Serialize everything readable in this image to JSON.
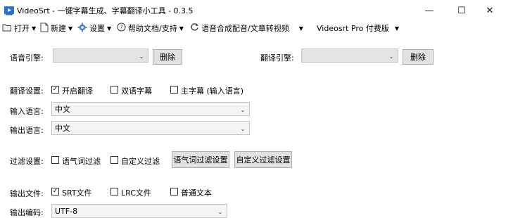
{
  "window": {
    "title": "VideoSrt - 一键字幕生成、字幕翻译小工具 - 0.3.5",
    "minimize": "—",
    "maximize": "☐",
    "close": "✕"
  },
  "menu": [
    {
      "label": "打开",
      "icon": "folder-icon"
    },
    {
      "label": "新建",
      "icon": "new-file-icon"
    },
    {
      "label": "设置",
      "icon": "gear-icon"
    },
    {
      "label": "帮助文档/支持",
      "icon": "help-icon"
    },
    {
      "label": "语音合成配音/文章转视频",
      "icon": "refresh-icon"
    },
    {
      "label": "Videosrt Pro 付费版",
      "icon": ""
    }
  ],
  "engines": {
    "speech_label": "语音引擎:",
    "speech_value": "",
    "speech_delete": "删除",
    "translate_label": "翻译引擎:",
    "translate_value": "",
    "translate_delete": "删除"
  },
  "translate_settings": {
    "label": "翻译设置:",
    "options": [
      {
        "label": "开启翻译",
        "checked": true
      },
      {
        "label": "双语字幕",
        "checked": false
      },
      {
        "label": "主字幕 (输入语言)",
        "checked": false
      }
    ]
  },
  "input_language": {
    "label": "输入语言:",
    "value": "中文"
  },
  "output_language": {
    "label": "输出语言:",
    "value": "中文"
  },
  "filter": {
    "label": "过滤设置:",
    "options": [
      {
        "label": "语气词过滤",
        "checked": false
      },
      {
        "label": "自定义过滤",
        "checked": false
      }
    ],
    "button1": "语气词过滤设置",
    "button2": "自定义过滤设置"
  },
  "output_files": {
    "label": "输出文件:",
    "options": [
      {
        "label": "SRT文件",
        "checked": true
      },
      {
        "label": "LRC文件",
        "checked": false
      },
      {
        "label": "普通文本",
        "checked": false
      }
    ]
  },
  "output_encoding": {
    "label": "输出编码:",
    "value": "UTF-8"
  }
}
